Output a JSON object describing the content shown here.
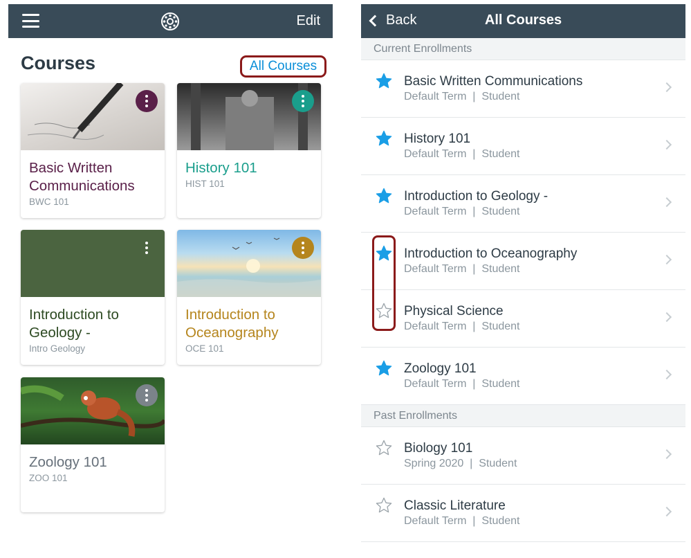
{
  "left": {
    "edit_label": "Edit",
    "heading": "Courses",
    "all_courses_link": "All Courses",
    "cards": [
      {
        "title": "Basic Written Communications",
        "code": "BWC 101",
        "title_color": "#5a2049",
        "menu_color": "#5a2049"
      },
      {
        "title": "History 101",
        "code": "HIST 101",
        "title_color": "#1a9e8c",
        "menu_color": "#1a9e8c"
      },
      {
        "title": "Introduction to Geology -",
        "code": "Intro Geology",
        "title_color": "#2d4a22",
        "menu_color": "#4b6440"
      },
      {
        "title": "Introduction to Oceanography",
        "code": "OCE 101",
        "title_color": "#b5851d",
        "menu_color": "#b5851d"
      },
      {
        "title": "Zoology 101",
        "code": "ZOO 101",
        "title_color": "#66707a",
        "menu_color": "#7b838a"
      }
    ]
  },
  "right": {
    "back_label": "Back",
    "title": "All Courses",
    "current_heading": "Current Enrollments",
    "past_heading": "Past Enrollments",
    "current": [
      {
        "title": "Basic Written Communications",
        "sub": "Default Term  |  Student",
        "starred": true
      },
      {
        "title": "History 101",
        "sub": "Default Term  |  Student",
        "starred": true
      },
      {
        "title": "Introduction to Geology -",
        "sub": "Default Term  |  Student",
        "starred": true
      },
      {
        "title": "Introduction to Oceanography",
        "sub": "Default Term  |  Student",
        "starred": true
      },
      {
        "title": "Physical Science",
        "sub": "Default Term  |  Student",
        "starred": false
      },
      {
        "title": "Zoology 101",
        "sub": "Default Term  |  Student",
        "starred": true
      }
    ],
    "past": [
      {
        "title": "Biology 101",
        "sub": "Spring 2020  |  Student",
        "starred": false
      },
      {
        "title": "Classic Literature",
        "sub": "Default Term  |  Student",
        "starred": false
      }
    ]
  },
  "colors": {
    "navbar": "#394b58",
    "link_blue": "#0a8ed8",
    "star_blue": "#1a9ee6",
    "highlight_red": "#8b1a1a"
  }
}
